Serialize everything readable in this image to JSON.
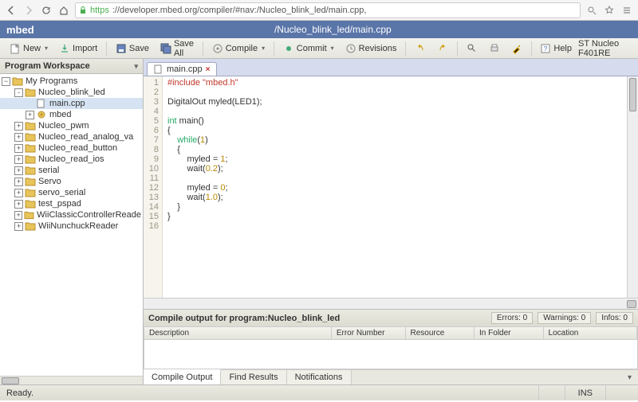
{
  "browser": {
    "protocol": "https",
    "url": "://developer.mbed.org/compiler/#nav:/Nucleo_blink_led/main.cpp,"
  },
  "app": {
    "name": "mbed",
    "title_path": "/Nucleo_blink_led/main.cpp"
  },
  "toolbar": {
    "new": "New",
    "import": "Import",
    "save": "Save",
    "save_all": "Save All",
    "compile": "Compile",
    "commit": "Commit",
    "revisions": "Revisions",
    "help": "Help",
    "device": "ST Nucleo F401RE"
  },
  "workspace": {
    "title": "Program Workspace",
    "root": "My Programs",
    "items": [
      {
        "label": "Nucleo_blink_led",
        "depth": 1,
        "exp": "-",
        "icon": "folder",
        "selected": false
      },
      {
        "label": "main.cpp",
        "depth": 2,
        "exp": "",
        "icon": "file",
        "selected": true
      },
      {
        "label": "mbed",
        "depth": 2,
        "exp": "+",
        "icon": "gear",
        "selected": false
      },
      {
        "label": "Nucleo_pwm",
        "depth": 1,
        "exp": "+",
        "icon": "folder",
        "selected": false
      },
      {
        "label": "Nucleo_read_analog_va",
        "depth": 1,
        "exp": "+",
        "icon": "folder",
        "selected": false
      },
      {
        "label": "Nucleo_read_button",
        "depth": 1,
        "exp": "+",
        "icon": "folder",
        "selected": false
      },
      {
        "label": "Nucleo_read_ios",
        "depth": 1,
        "exp": "+",
        "icon": "folder",
        "selected": false
      },
      {
        "label": "serial",
        "depth": 1,
        "exp": "+",
        "icon": "folder",
        "selected": false
      },
      {
        "label": "Servo",
        "depth": 1,
        "exp": "+",
        "icon": "folder",
        "selected": false
      },
      {
        "label": "servo_serial",
        "depth": 1,
        "exp": "+",
        "icon": "folder",
        "selected": false
      },
      {
        "label": "test_pspad",
        "depth": 1,
        "exp": "+",
        "icon": "folder",
        "selected": false
      },
      {
        "label": "WiiClassicControllerReade",
        "depth": 1,
        "exp": "+",
        "icon": "folder",
        "selected": false
      },
      {
        "label": "WiiNunchuckReader",
        "depth": 1,
        "exp": "+",
        "icon": "folder",
        "selected": false
      }
    ]
  },
  "editor": {
    "tab_name": "main.cpp",
    "lines": [
      {
        "n": 1,
        "html": "<span class='pp'>#include \"mbed.h\"</span>"
      },
      {
        "n": 2,
        "html": ""
      },
      {
        "n": 3,
        "html": "DigitalOut myled(LED1);"
      },
      {
        "n": 4,
        "html": ""
      },
      {
        "n": 5,
        "html": "<span class='kw'>int</span> main()"
      },
      {
        "n": 6,
        "html": "{"
      },
      {
        "n": 7,
        "html": "    <span class='kw'>while</span>(<span class='num'>1</span>)"
      },
      {
        "n": 8,
        "html": "    {"
      },
      {
        "n": 9,
        "html": "        myled = <span class='num'>1</span>;"
      },
      {
        "n": 10,
        "html": "        wait(<span class='num'>0.2</span>);"
      },
      {
        "n": 11,
        "html": ""
      },
      {
        "n": 12,
        "html": "        myled = <span class='num'>0</span>;"
      },
      {
        "n": 13,
        "html": "        wait(<span class='num'>1.0</span>);"
      },
      {
        "n": 14,
        "html": "    }"
      },
      {
        "n": 15,
        "html": "}"
      },
      {
        "n": 16,
        "html": ""
      }
    ]
  },
  "output": {
    "heading_prefix": "Compile output for program: ",
    "program": "Nucleo_blink_led",
    "errors_label": "Errors: 0",
    "warnings_label": "Warnings: 0",
    "infos_label": "Infos: 0",
    "columns": [
      "Description",
      "Error Number",
      "Resource",
      "In Folder",
      "Location"
    ],
    "tabs": [
      "Compile Output",
      "Find Results",
      "Notifications"
    ]
  },
  "status": {
    "ready": "Ready.",
    "mode": "INS"
  }
}
